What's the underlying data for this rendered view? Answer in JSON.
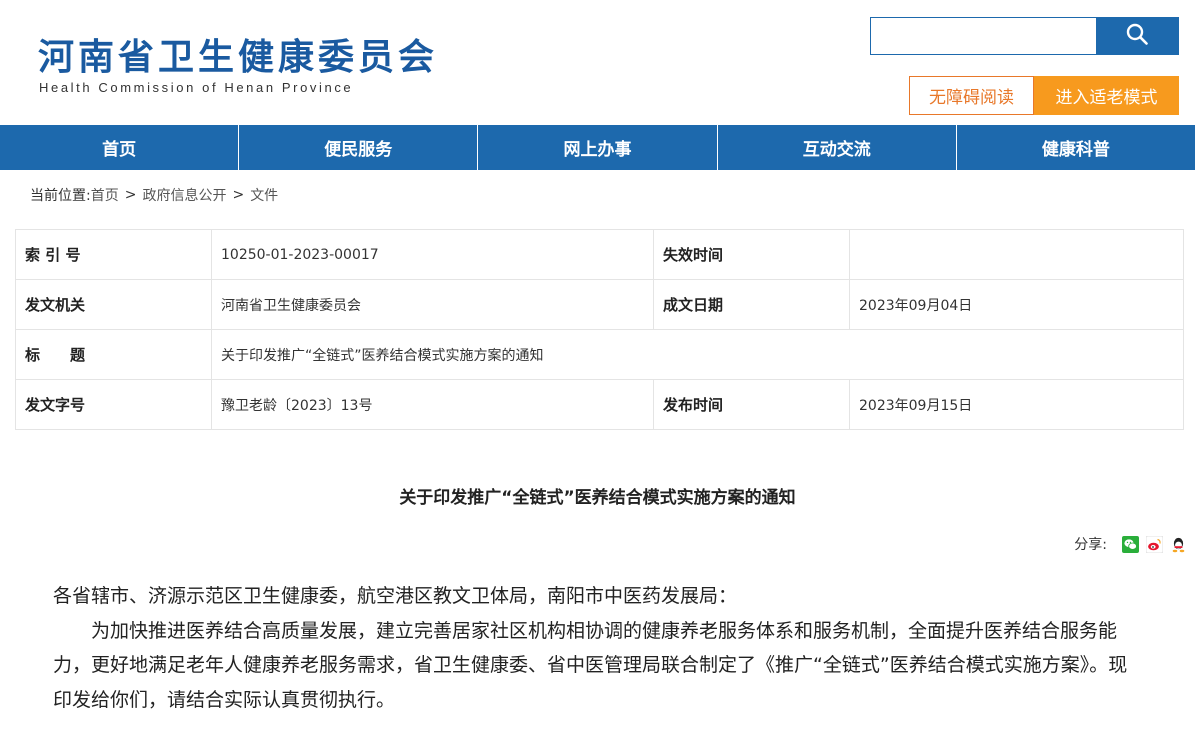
{
  "header": {
    "title": "河南省卫生健康委员会",
    "subtitle": "Health Commission of Henan Province",
    "search_placeholder": "",
    "accessibility_label": "无障碍阅读",
    "elder_mode_label": "进入适老模式"
  },
  "nav": {
    "items": [
      "首页",
      "便民服务",
      "网上办事",
      "互动交流",
      "健康科普"
    ]
  },
  "breadcrumb": {
    "prefix": "当前位置:",
    "items": [
      "首页",
      "政府信息公开",
      "文件"
    ],
    "separator": ">"
  },
  "info": {
    "rows": [
      {
        "label1": "索 引 号",
        "value1": "10250-01-2023-00017",
        "label2": "失效时间",
        "value2": ""
      },
      {
        "label1": "发文机关",
        "value1": "河南省卫生健康委员会",
        "label2": "成文日期",
        "value2": "2023年09月04日"
      },
      {
        "label1": "标　　题",
        "value1": "关于印发推广“全链式”医养结合模式实施方案的通知"
      },
      {
        "label1": "发文字号",
        "value1": "豫卫老龄〔2023〕13号",
        "label2": "发布时间",
        "value2": "2023年09月15日"
      }
    ]
  },
  "article": {
    "title": "关于印发推广“全链式”医养结合模式实施方案的通知",
    "share_label": "分享:",
    "share_icons": [
      "wechat-icon",
      "weibo-icon",
      "qq-icon"
    ],
    "salutation": "各省辖市、济源示范区卫生健康委，航空港区教文卫体局，南阳市中医药发展局：",
    "body": "为加快推进医养结合高质量发展，建立完善居家社区机构相协调的健康养老服务体系和服务机制，全面提升医养结合服务能力，更好地满足老年人健康养老服务需求，省卫生健康委、省中医管理局联合制定了《推广“全链式”医养结合模式实施方案》。现印发给你们，请结合实际认真贯彻执行。"
  },
  "colors": {
    "brand_blue": "#1d69ad",
    "title_blue": "#1a5aa0",
    "accent_orange": "#f79a1e",
    "outline_orange": "#e8782a"
  }
}
